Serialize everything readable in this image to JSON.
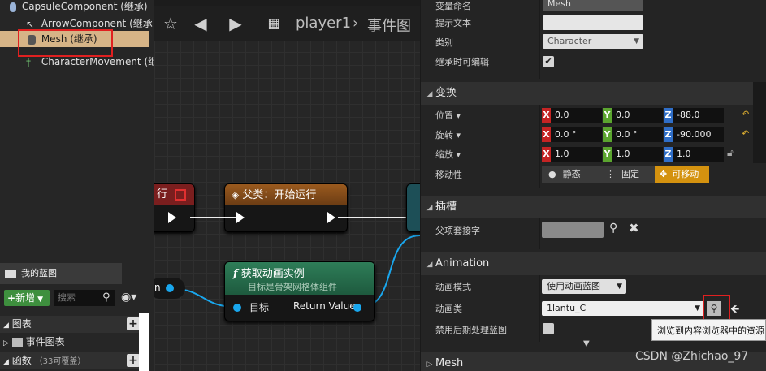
{
  "components": {
    "items": [
      {
        "label": "CapsuleComponent (继承)"
      },
      {
        "label": "ArrowComponent (继承)"
      },
      {
        "label": "Mesh (继承)"
      },
      {
        "label": "CharacterMovement (继承)"
      }
    ]
  },
  "toolbar": {
    "breadcrumb": "player1",
    "current": "事件图"
  },
  "graph": {
    "node_cut_label": "行",
    "node_parent_title": "父类：开始运行",
    "node_anim_title": "获取动画实例",
    "node_anim_subtitle": "目标是骨架网格体组件",
    "pin_target": "目标",
    "pin_return": "Return Value",
    "pin_left_cut": "n"
  },
  "my_blueprint": {
    "tab": "我的蓝图",
    "new_button": "新增",
    "search_placeholder": "搜索",
    "categories": [
      {
        "label": "图表"
      },
      {
        "label": "事件图表"
      },
      {
        "label": "函数",
        "note": "（33可覆盖）"
      }
    ]
  },
  "details": {
    "variable_name_label": "变量命名",
    "variable_name_value": "Mesh",
    "tooltip_label": "提示文本",
    "tooltip_value": "",
    "category_label": "类别",
    "category_value": "Character",
    "editable_label": "继承时可编辑",
    "transform_header": "变换",
    "location_label": "位置",
    "rotation_label": "旋转",
    "scale_label": "缩放",
    "mobility_label": "移动性",
    "location": {
      "x": "0.0",
      "y": "0.0",
      "z": "-88.0"
    },
    "rotation": {
      "x": "0.0 °",
      "y": "0.0 °",
      "z": "-90.000"
    },
    "scale": {
      "x": "1.0",
      "y": "1.0",
      "z": "1.0"
    },
    "mobility_options": [
      "静态",
      "固定",
      "可移动"
    ],
    "socket_header": "插槽",
    "parent_socket_label": "父项套接字",
    "animation_header": "Animation",
    "anim_mode_label": "动画模式",
    "anim_mode_value": "使用动画蓝图",
    "anim_class_label": "动画类",
    "anim_class_value": "1lantu_C",
    "disable_post_label": "禁用后期处理蓝图",
    "mesh_header": "Mesh",
    "tooltip_text": "浏览到内容浏览器中的资源"
  },
  "watermark": "CSDN @Zhichao_97",
  "colors": {
    "selection": "#d6b487",
    "highlight_box": "#e02020",
    "pin_blue": "#19a7ee",
    "axis_x": "#c52424",
    "axis_y": "#5ba52f",
    "axis_z": "#2f6ec8",
    "movable": "#d4920f"
  }
}
